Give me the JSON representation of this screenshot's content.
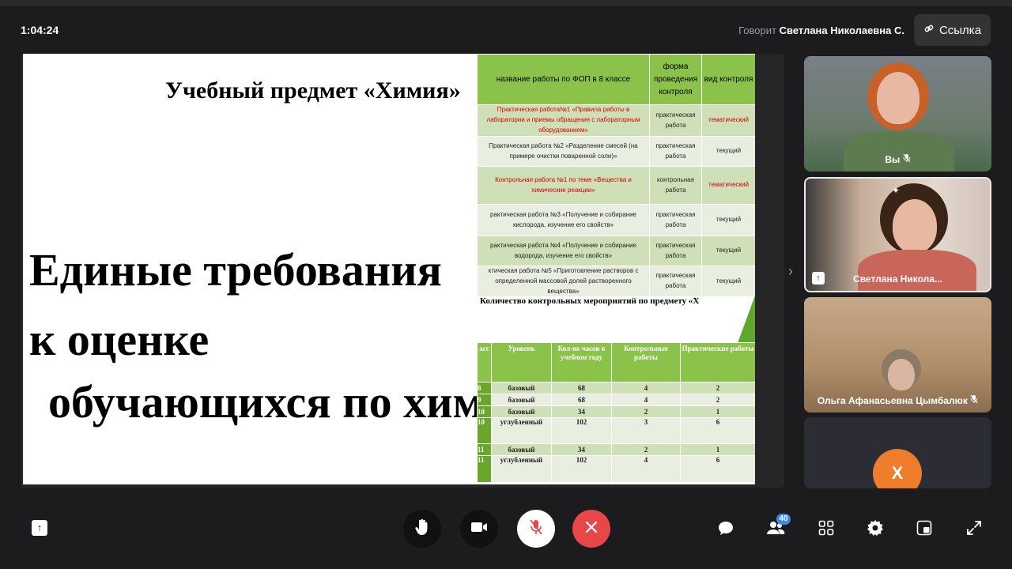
{
  "header": {
    "time": "1:04:24",
    "speaker_prefix": "Говорит",
    "speaker_name": "Светлана Николаевна С.",
    "link_label": "Ссылка"
  },
  "slide": {
    "subject": "Учебный предмет «Химия»",
    "title_lines": [
      "Единые требования",
      "к оценке",
      "обучающихся по химии"
    ],
    "table1": {
      "headers": [
        "название работы по ФОП в 8 классе",
        "форма проведения контроля",
        "вид контроля"
      ],
      "rows": [
        {
          "name": "Практическая работа№1 «Правила работы в лаборатории и приемы обращения с лабораторным оборудованием»",
          "form": "практическая работа",
          "type": "тематический"
        },
        {
          "name": "Практическая работа №2 «Разделение смесей (на примере очистки поваренной соли)»",
          "form": "практическая работа",
          "type": "текущий"
        },
        {
          "name": "Контрольная работа №1 по теме «Вещества и химические реакции»",
          "form": "контрольная работа",
          "type": "тематический"
        },
        {
          "name": "рактическая работа №3 «Получение и собирание кислорода, изучение его свойств»",
          "form": "практическая работа",
          "type": "текущий"
        },
        {
          "name": "рактическая работа №4 «Получение и собирание водорода, изучение его свойств»",
          "form": "практическая работа",
          "type": "текущий"
        },
        {
          "name": "ктическая работа №5 «Приготовление растворов с определенной массовой долей растворенного вещества»",
          "form": "практическая работа",
          "type": "текущий"
        }
      ]
    },
    "table2": {
      "title": "Количество контрольных мероприятий по предмету «Х",
      "headers": [
        "асс",
        "Уровень",
        "Кол-во часов в учебном году",
        "Контрольные работы",
        "Практические работы"
      ],
      "rows": [
        [
          "8",
          "базовый",
          "68",
          "4",
          "2"
        ],
        [
          "9",
          "базовый",
          "68",
          "4",
          "2"
        ],
        [
          "10",
          "базовый",
          "34",
          "2",
          "1"
        ],
        [
          "10",
          "углубленный",
          "102",
          "3",
          "6"
        ],
        [
          "11",
          "базовый",
          "34",
          "2",
          "1"
        ],
        [
          "11",
          "углубленный",
          "102",
          "4",
          "6"
        ]
      ]
    }
  },
  "participants": [
    {
      "name": "Вы",
      "muted": true
    },
    {
      "name": "Светлана Никола...",
      "pinned": true
    },
    {
      "name": "Ольга Афанасьевна Цымбалюк",
      "muted": true
    },
    {
      "initial": "Х"
    }
  ],
  "toolbar": {
    "participants_count": "40"
  },
  "colors": {
    "background": "#1c1c1e",
    "end_call": "#e8474a",
    "badge": "#3b8bea",
    "table_header": "#8bc34a",
    "avatar": "#f07d2c"
  }
}
